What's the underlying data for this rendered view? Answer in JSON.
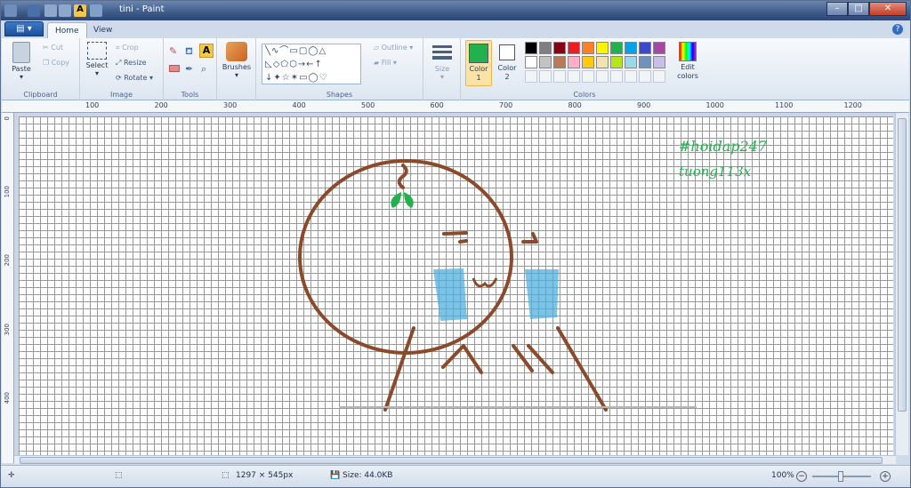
{
  "window": {
    "title": "tini - Paint"
  },
  "tabs": {
    "file": "",
    "home": "Home",
    "view": "View",
    "help": "?"
  },
  "clipboard": {
    "paste": "Paste",
    "cut": "Cut",
    "copy": "Copy",
    "label": "Clipboard"
  },
  "image": {
    "select": "Select",
    "crop": "Crop",
    "resize": "Resize",
    "rotate": "Rotate",
    "label": "Image"
  },
  "tools": {
    "label": "Tools",
    "brushes": "Brushes"
  },
  "shapes": {
    "outline": "Outline",
    "fill": "Fill",
    "label": "Shapes"
  },
  "size": {
    "label": "Size"
  },
  "colors": {
    "color1_label": "Color\n1",
    "color2_label": "Color\n2",
    "edit": "Edit\ncolors",
    "label": "Colors",
    "color1": "#22b14c",
    "color2": "#ffffff",
    "palette": [
      "#000000",
      "#7f7f7f",
      "#880015",
      "#ed1c24",
      "#ff7f27",
      "#fff200",
      "#22b14c",
      "#00a2e8",
      "#3f48cc",
      "#a349a4",
      "#ffffff",
      "#c3c3c3",
      "#b97a57",
      "#ffaec9",
      "#ffc90e",
      "#efe4b0",
      "#b5e61d",
      "#99d9ea",
      "#7092be",
      "#c8bfe7"
    ]
  },
  "ruler": {
    "h_ticks": [
      "100",
      "200",
      "300",
      "400",
      "500",
      "600",
      "700",
      "800",
      "900",
      "1000",
      "1100",
      "1200"
    ],
    "v_ticks": [
      "0",
      "100",
      "200",
      "300",
      "400"
    ]
  },
  "canvas": {
    "text1": "#hoidap247",
    "text2": "tuong113x",
    "stroke": "#8b4a2b",
    "tear": "#4fb0e0",
    "leaf": "#22b14c"
  },
  "status": {
    "dimensions": "1297 × 545px",
    "size": "Size: 44.0KB",
    "zoom": "100%"
  }
}
